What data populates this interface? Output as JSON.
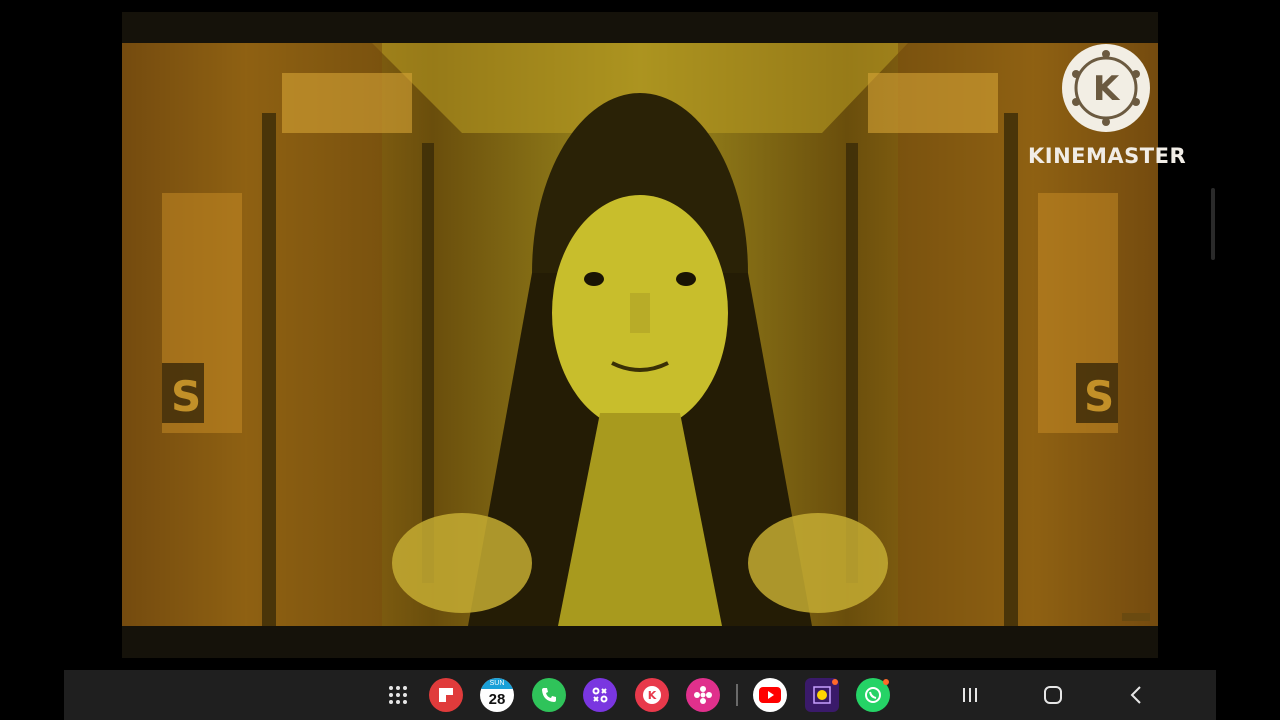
{
  "watermark": {
    "text": "KINEMASTER",
    "logo_letter": "K",
    "logo_icon": "kinemaster-logo"
  },
  "video": {
    "frame_description_icon": "video-frame",
    "sign_letter": "S",
    "corner_badge_icon": "small-channel-badge"
  },
  "taskbar": {
    "apps": [
      {
        "name": "app-drawer",
        "icon": "grid-dots-icon"
      },
      {
        "name": "flipboard",
        "icon": "flipboard-icon",
        "color": "#e03b3b"
      },
      {
        "name": "calendar",
        "icon": "calendar-icon",
        "day_label": "SUN",
        "date": "28",
        "color": "#1aa0d8"
      },
      {
        "name": "phone",
        "icon": "phone-icon",
        "color": "#2fc35a"
      },
      {
        "name": "game-launcher",
        "icon": "game-launcher-icon",
        "color": "#7a36e0"
      },
      {
        "name": "kinemaster",
        "icon": "kinemaster-icon",
        "color": "#e8394b"
      },
      {
        "name": "gallery",
        "icon": "gallery-icon",
        "color": "#e0308c"
      },
      {
        "name": "youtube",
        "icon": "youtube-icon",
        "color": "#ffffff"
      },
      {
        "name": "pacman-game",
        "icon": "pacman-game-icon",
        "color": "#3a1a6a"
      },
      {
        "name": "whatsapp",
        "icon": "whatsapp-icon",
        "color": "#25d366"
      }
    ],
    "nav": {
      "recents_icon": "recents-icon",
      "home_icon": "home-icon",
      "back_icon": "back-icon"
    }
  }
}
